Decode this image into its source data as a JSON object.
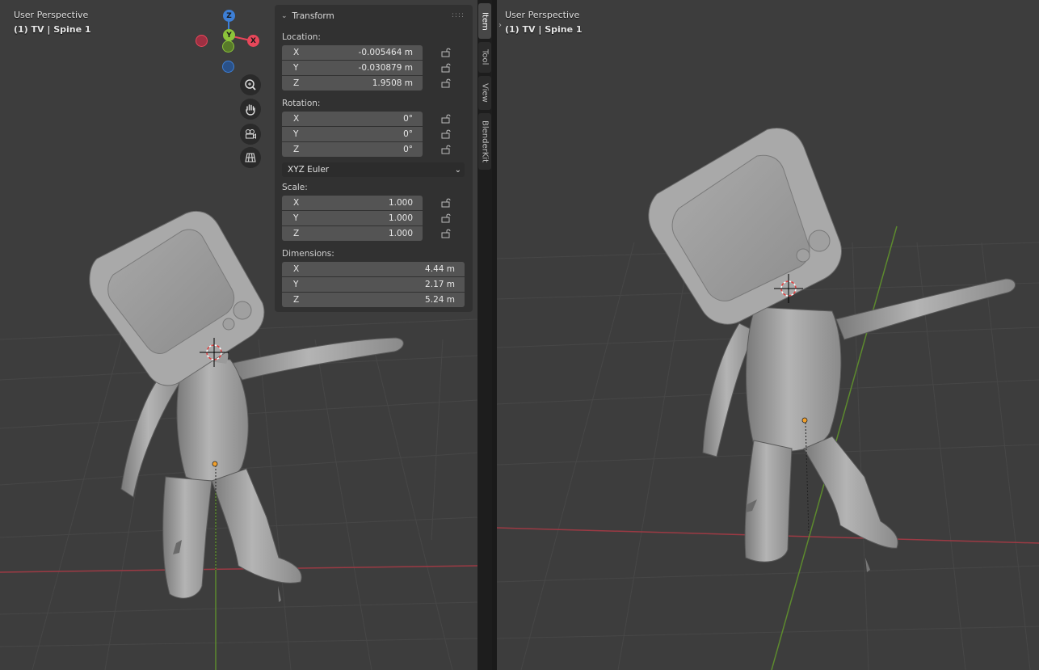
{
  "left_viewport": {
    "mode": "User Perspective",
    "context": "(1) TV | Spine 1"
  },
  "right_viewport": {
    "mode": "User Perspective",
    "context": "(1) TV | Spine 1"
  },
  "gizmo": {
    "x": "X",
    "y": "Y",
    "z": "Z"
  },
  "nav_icons": [
    "zoom-icon",
    "hand-pan-icon",
    "camera-icon",
    "perspective-grid-icon"
  ],
  "panel": {
    "title": "Transform",
    "location": {
      "label": "Location:",
      "fields": [
        {
          "axis": "X",
          "value": "-0.005464 m"
        },
        {
          "axis": "Y",
          "value": "-0.030879 m"
        },
        {
          "axis": "Z",
          "value": "1.9508 m"
        }
      ]
    },
    "rotation": {
      "label": "Rotation:",
      "fields": [
        {
          "axis": "X",
          "value": "0°"
        },
        {
          "axis": "Y",
          "value": "0°"
        },
        {
          "axis": "Z",
          "value": "0°"
        }
      ],
      "mode": "XYZ Euler"
    },
    "scale": {
      "label": "Scale:",
      "fields": [
        {
          "axis": "X",
          "value": "1.000"
        },
        {
          "axis": "Y",
          "value": "1.000"
        },
        {
          "axis": "Z",
          "value": "1.000"
        }
      ]
    },
    "dimensions": {
      "label": "Dimensions:",
      "fields": [
        {
          "axis": "X",
          "value": "4.44 m"
        },
        {
          "axis": "Y",
          "value": "2.17 m"
        },
        {
          "axis": "Z",
          "value": "5.24 m"
        }
      ]
    }
  },
  "sidebar_tabs": [
    {
      "label": "Item",
      "active": true
    },
    {
      "label": "Tool",
      "active": false
    },
    {
      "label": "View",
      "active": false
    },
    {
      "label": "BlenderKit",
      "active": false
    }
  ],
  "colors": {
    "viewport_bg": "#3d3d3d",
    "x_axis": "#e8475a",
    "y_axis": "#8cc43a",
    "z_axis": "#3d7fd6",
    "panel_bg": "#303030",
    "field_bg": "#545454"
  }
}
